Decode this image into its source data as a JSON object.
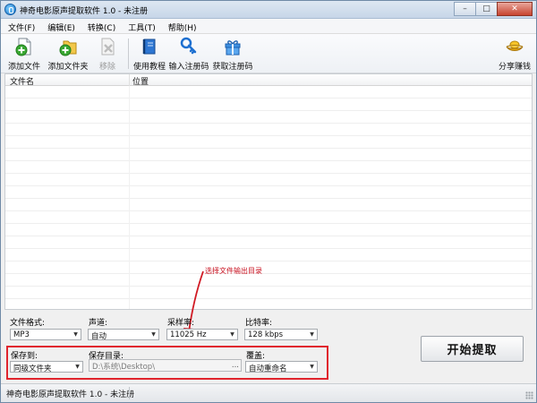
{
  "window": {
    "title": "神奇电影原声提取软件 1.0 - 未注册",
    "controls": {
      "minimize": "–",
      "maximize": "□",
      "close": "✕"
    }
  },
  "menu": [
    "文件(F)",
    "编辑(E)",
    "转换(C)",
    "工具(T)",
    "帮助(H)"
  ],
  "toolbar": {
    "add_file": "添加文件",
    "add_folder": "添加文件夹",
    "remove": "移除",
    "tutorial": "使用教程",
    "enter_code": "输入注册码",
    "get_code": "获取注册码",
    "share": "分享赚钱",
    "icons": {
      "add_file": "add-file-icon",
      "add_folder": "add-folder-icon",
      "remove": "remove-icon",
      "tutorial": "book-icon",
      "enter_code": "key-icon",
      "get_code": "gift-icon",
      "share": "gold-ingot-icon"
    }
  },
  "list": {
    "columns": [
      "文件名",
      "位置"
    ],
    "rows": []
  },
  "annotation": {
    "text": "选择文件输出目录",
    "color": "#c8101f"
  },
  "settings": {
    "format_label": "文件格式:",
    "format_value": "MP3",
    "channel_label": "声道:",
    "channel_value": "自动",
    "samplerate_label": "采样率:",
    "samplerate_value": "11025 Hz",
    "bitrate_label": "比特率:",
    "bitrate_value": "128 kbps",
    "saveto_label": "保存到:",
    "saveto_value": "同级文件夹",
    "savedir_label": "保存目录:",
    "savedir_value": "D:\\系统\\Desktop\\",
    "savedir_browse": "...",
    "overwrite_label": "覆盖:",
    "overwrite_value": "自动重命名"
  },
  "start_button": "开始提取",
  "status": {
    "text": "神奇电影原声提取软件 1.0 - 未注册"
  },
  "colors": {
    "highlight": "#e0242d",
    "title_bar": "#c7d6e8"
  }
}
